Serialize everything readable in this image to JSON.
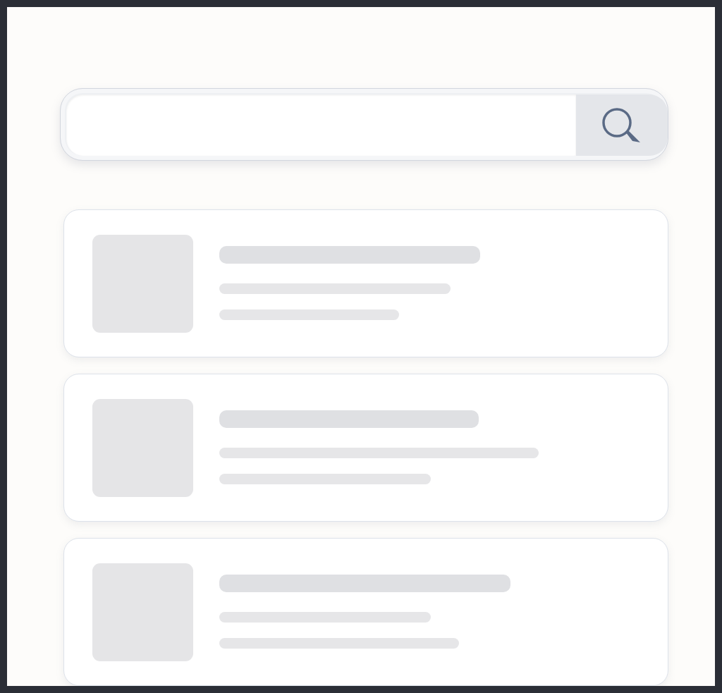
{
  "search": {
    "has_button": true
  },
  "results": [
    {
      "kind": "skeleton"
    },
    {
      "kind": "skeleton"
    },
    {
      "kind": "skeleton"
    }
  ]
}
